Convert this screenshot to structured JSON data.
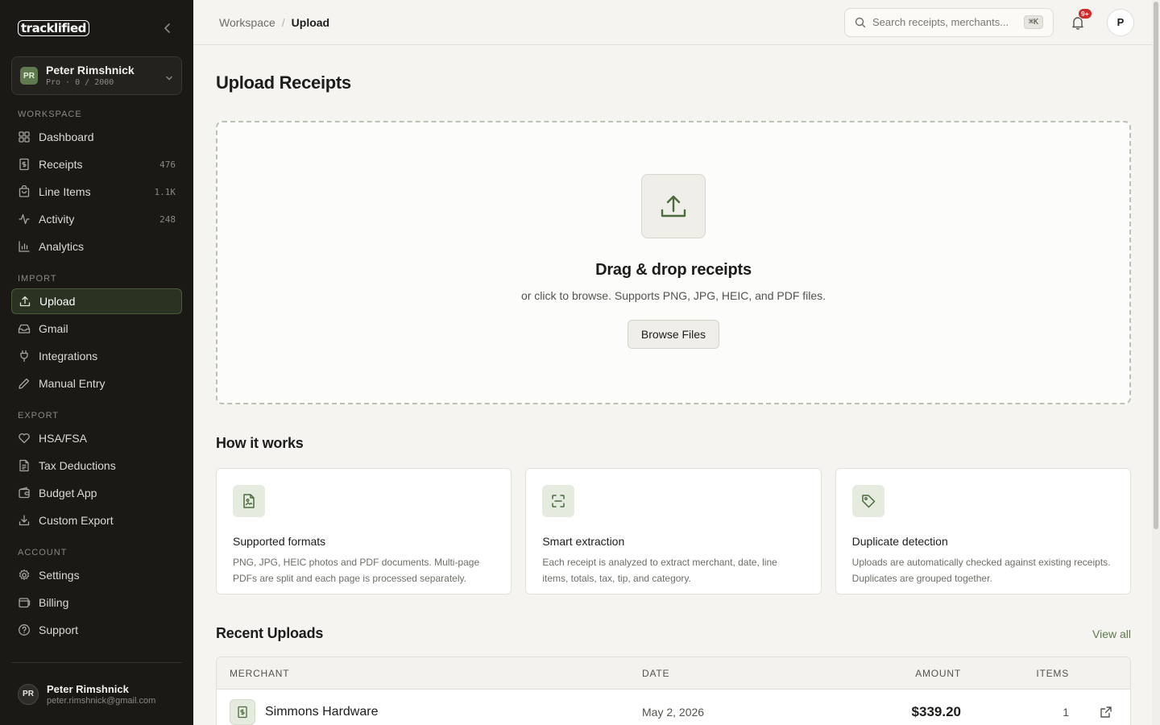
{
  "app": {
    "logo_text": "tracklified"
  },
  "account": {
    "initials": "PR",
    "name": "Peter Rimshnick",
    "plan": "Pro · 0 / 2000"
  },
  "sidebar": {
    "sections": [
      {
        "label": "WORKSPACE",
        "items": [
          {
            "label": "Dashboard",
            "icon": "dashboard-icon",
            "count": ""
          },
          {
            "label": "Receipts",
            "icon": "receipt-icon",
            "count": "476"
          },
          {
            "label": "Line Items",
            "icon": "shopping-bag-icon",
            "count": "1.1K"
          },
          {
            "label": "Activity",
            "icon": "activity-icon",
            "count": "248"
          },
          {
            "label": "Analytics",
            "icon": "bar-chart-icon",
            "count": ""
          }
        ]
      },
      {
        "label": "IMPORT",
        "items": [
          {
            "label": "Upload",
            "icon": "upload-icon",
            "count": "",
            "active": true
          },
          {
            "label": "Gmail",
            "icon": "mail-icon",
            "count": ""
          },
          {
            "label": "Integrations",
            "icon": "plug-icon",
            "count": ""
          },
          {
            "label": "Manual Entry",
            "icon": "pencil-icon",
            "count": ""
          }
        ]
      },
      {
        "label": "EXPORT",
        "items": [
          {
            "label": "HSA/FSA",
            "icon": "heart-icon",
            "count": ""
          },
          {
            "label": "Tax Deductions",
            "icon": "document-icon",
            "count": ""
          },
          {
            "label": "Budget App",
            "icon": "wallet-icon",
            "count": ""
          },
          {
            "label": "Custom Export",
            "icon": "download-icon",
            "count": ""
          }
        ]
      },
      {
        "label": "ACCOUNT",
        "items": [
          {
            "label": "Settings",
            "icon": "gear-icon",
            "count": ""
          },
          {
            "label": "Billing",
            "icon": "credit-card-icon",
            "count": ""
          },
          {
            "label": "Support",
            "icon": "help-circle-icon",
            "count": ""
          }
        ]
      }
    ],
    "footer": {
      "initials": "PR",
      "name": "Peter Rimshnick",
      "email": "peter.rimshnick@gmail.com"
    }
  },
  "topbar": {
    "breadcrumb_parent": "Workspace",
    "breadcrumb_sep": "/",
    "breadcrumb_current": "Upload",
    "search_placeholder": "Search receipts, merchants...",
    "search_shortcut": "⌘K",
    "notification_badge": "9+",
    "user_initial": "P"
  },
  "page": {
    "title": "Upload Receipts",
    "dropzone": {
      "title": "Drag & drop receipts",
      "subtitle": "or click to browse. Supports PNG, JPG, HEIC, and PDF files.",
      "button": "Browse Files"
    },
    "how_it_works": {
      "title": "How it works",
      "cards": [
        {
          "icon": "image-file-icon",
          "title": "Supported formats",
          "desc": "PNG, JPG, HEIC photos and PDF documents. Multi-page PDFs are split and each page is processed separately."
        },
        {
          "icon": "scan-icon",
          "title": "Smart extraction",
          "desc": "Each receipt is analyzed to extract merchant, date, line items, totals, tax, tip, and category."
        },
        {
          "icon": "tag-icon",
          "title": "Duplicate detection",
          "desc": "Uploads are automatically checked against existing receipts. Duplicates are grouped together."
        }
      ]
    },
    "recent": {
      "title": "Recent Uploads",
      "view_all": "View all",
      "columns": {
        "merchant": "MERCHANT",
        "date": "DATE",
        "amount": "AMOUNT",
        "items": "ITEMS"
      },
      "rows": [
        {
          "merchant": "Simmons Hardware",
          "date": "May 2, 2026",
          "amount": "$339.20",
          "items": "1"
        }
      ]
    }
  },
  "colors": {
    "sidebar_bg": "#1a1916",
    "accent": "#5f7a4e",
    "page_bg": "#f5f4f0",
    "badge": "#d12a2a"
  }
}
